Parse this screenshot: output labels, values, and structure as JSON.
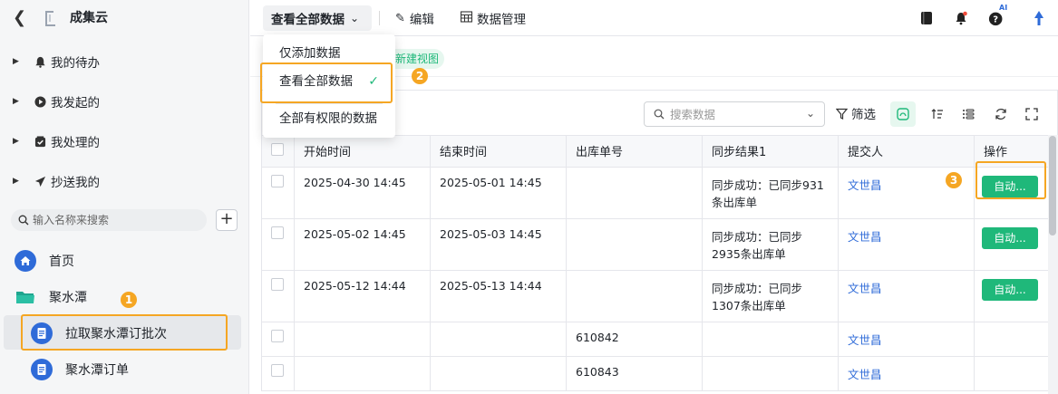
{
  "sidebar": {
    "app_title": "成集云",
    "groups": [
      {
        "label": "我的待办",
        "icon": "bell-icon"
      },
      {
        "label": "我发起的",
        "icon": "play-circle-icon"
      },
      {
        "label": "我处理的",
        "icon": "check-box-icon"
      },
      {
        "label": "抄送我的",
        "icon": "send-icon"
      }
    ],
    "search_placeholder": "输入名称来搜索",
    "nav": [
      {
        "label": "首页",
        "icon": "home-icon"
      },
      {
        "label": "聚水潭",
        "icon": "folder-icon"
      },
      {
        "label": "拉取聚水潭订批次",
        "icon": "form-icon",
        "active": true
      },
      {
        "label": "聚水潭订单",
        "icon": "form-icon"
      }
    ]
  },
  "topbar": {
    "view_selector_label": "查看全部数据",
    "edit_label": "编辑",
    "data_manage_label": "数据管理",
    "ai_badge": "AI"
  },
  "subbar": {
    "new_view_label": "新建视图"
  },
  "dropdown": {
    "items": [
      {
        "label": "仅添加数据",
        "selected": false
      },
      {
        "label": "查看全部数据",
        "selected": true
      },
      {
        "label": "全部有权限的数据",
        "selected": false
      }
    ],
    "check_mark": "✓"
  },
  "table_toolbar": {
    "search_placeholder": "搜索数据",
    "filter_label": "筛选"
  },
  "table": {
    "columns": [
      "开始时间",
      "结束时间",
      "出库单号",
      "同步结果1",
      "提交人",
      "操作"
    ],
    "rows": [
      {
        "start": "2025-04-30 14:45",
        "end": "2025-05-01 14:45",
        "order_no": "",
        "sync": "同步成功：已同步931条出库单",
        "user": "文世昌",
        "action": "自动..."
      },
      {
        "start": "2025-05-02 14:45",
        "end": "2025-05-03 14:45",
        "order_no": "",
        "sync": "同步成功：已同步2935条出库单",
        "user": "文世昌",
        "action": "自动..."
      },
      {
        "start": "2025-05-12 14:44",
        "end": "2025-05-13 14:44",
        "order_no": "",
        "sync": "同步成功：已同步1307条出库单",
        "user": "文世昌",
        "action": "自动..."
      },
      {
        "start": "",
        "end": "",
        "order_no": "610842",
        "sync": "",
        "user": "文世昌",
        "action": ""
      },
      {
        "start": "",
        "end": "",
        "order_no": "610843",
        "sync": "",
        "user": "文世昌",
        "action": ""
      }
    ]
  },
  "annotations": {
    "step1": "1",
    "step2": "2",
    "step3": "3",
    "accent_color": "#f5a623"
  },
  "colors": {
    "brand_green": "#1fb87a",
    "link_blue": "#2f6bd8"
  }
}
